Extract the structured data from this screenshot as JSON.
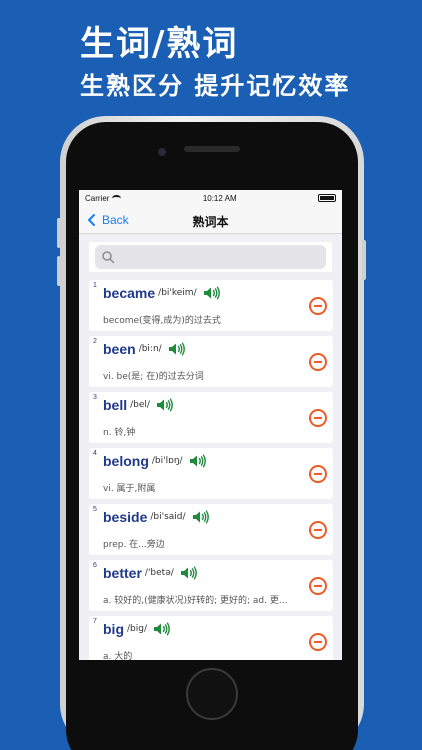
{
  "promo": {
    "headline": "生词/熟词",
    "subline": "生熟区分 提升记忆效率"
  },
  "status_bar": {
    "carrier": "Carrier",
    "time": "10:12 AM"
  },
  "nav": {
    "back_label": "Back",
    "title": "熟词本"
  },
  "search": {
    "placeholder": ""
  },
  "words": [
    {
      "index": "1",
      "word": "became",
      "phonetic": "/bi'keim/",
      "meaning": "become(变得,成为)的过去式"
    },
    {
      "index": "2",
      "word": "been",
      "phonetic": "/bi:n/",
      "meaning": "vi. be(是; 在)的过去分词"
    },
    {
      "index": "3",
      "word": "bell",
      "phonetic": "/bel/",
      "meaning": "n. 铃,钟"
    },
    {
      "index": "4",
      "word": "belong",
      "phonetic": "/bi'lɒŋ/",
      "meaning": "vi. 属于,附属"
    },
    {
      "index": "5",
      "word": "beside",
      "phonetic": "/bi'said/",
      "meaning": "prep. 在...旁边"
    },
    {
      "index": "6",
      "word": "better",
      "phonetic": "/'betə/",
      "meaning": "a. 较好的,(健康状况)好转的; 更好的; ad. 更..."
    },
    {
      "index": "7",
      "word": "big",
      "phonetic": "/big/",
      "meaning": "a. 大的"
    }
  ],
  "colors": {
    "background": "#1a5fb4",
    "accent": "#1e7bf3",
    "word": "#1f3a8a",
    "speaker": "#1e8a3c",
    "remove": "#f05a28"
  },
  "icons": {
    "back": "chevron-left-icon",
    "search": "search-icon",
    "speaker": "speaker-icon",
    "remove": "remove-circle-icon",
    "wifi": "wifi-icon",
    "battery": "battery-icon"
  }
}
